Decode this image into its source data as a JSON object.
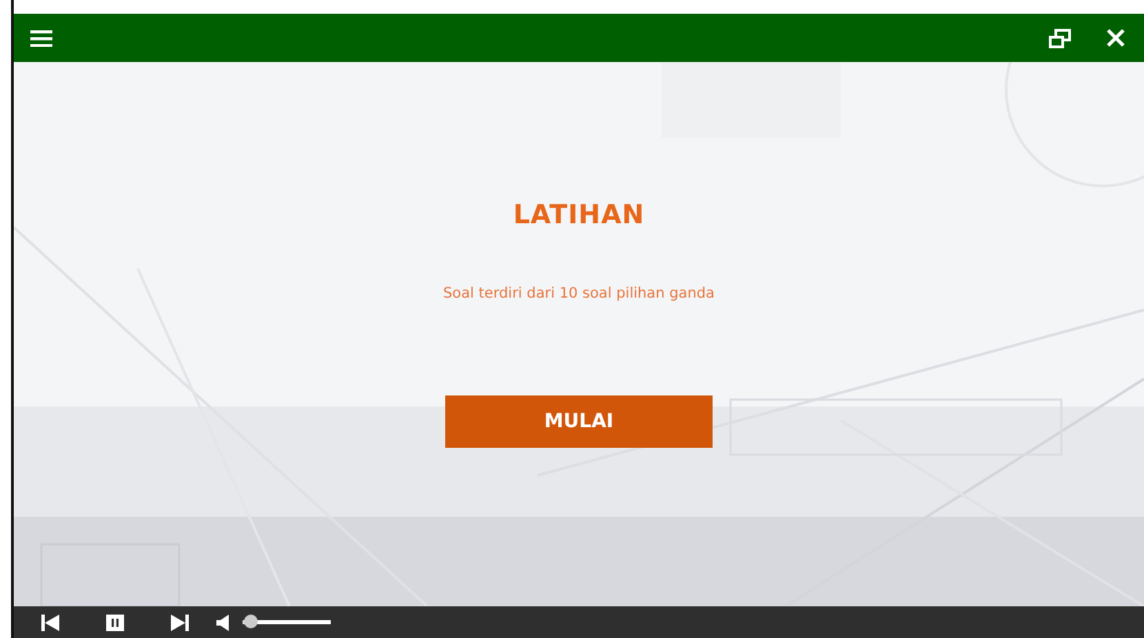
{
  "title": "LATIHAN",
  "description": "Soal terdiri dari 10 soal pilihan ganda",
  "start_button": "MULAI",
  "player": {
    "volume": {
      "level": 0.1
    }
  }
}
